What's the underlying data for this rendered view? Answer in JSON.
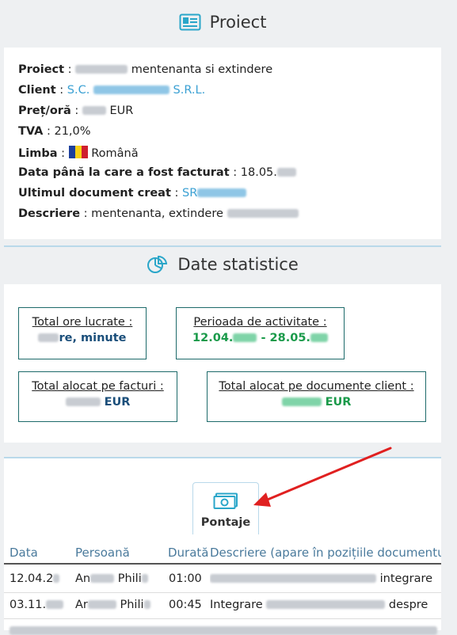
{
  "project_section": {
    "title": "Proiect",
    "fields": [
      {
        "label": "Proiect",
        "value": "mentenanta si extindere"
      },
      {
        "label": "Client",
        "value_pre": "S.C.",
        "value_post": "S.R.L."
      },
      {
        "label": "Preț/oră",
        "value": "EUR"
      },
      {
        "label": "TVA",
        "value": "21,0%"
      },
      {
        "label": "Limba",
        "value": "Română"
      },
      {
        "label": "Data până la care a fost facturat",
        "value": "18.05."
      },
      {
        "label": "Ultimul document creat",
        "value": "SR"
      },
      {
        "label": "Descriere",
        "value": "mentenanta, extindere"
      }
    ]
  },
  "stats_section": {
    "title": "Date statistice",
    "total_hours": {
      "label": "Total ore lucrate :",
      "value_post": "re, minute"
    },
    "activity_period": {
      "label": "Perioada de activitate :",
      "value_pre": "12.04.",
      "value_post": "- 28.05."
    },
    "total_invoices": {
      "label": "Total alocat pe facturi :",
      "value": "EUR"
    },
    "total_client_docs": {
      "label": "Total alocat pe documente client :",
      "value": "EUR"
    }
  },
  "timesheet": {
    "tab_label": "Pontaje",
    "headers": [
      "Data",
      "Persoană",
      "Durată",
      "Descriere (apare în pozițiile documentului)"
    ],
    "rows": [
      {
        "date": "12.04.2",
        "person_a": "An",
        "person_b": "Phili",
        "duration": "01:00",
        "desc_pre": "",
        "desc_post": "integrare"
      },
      {
        "date": "03.11.",
        "person_a": "Ar",
        "person_b": "Phili",
        "duration": "00:45",
        "desc_pre": "Integrare",
        "desc_post": "despre"
      }
    ]
  },
  "colors": {
    "accent": "#3aa0d3",
    "green": "#1a9a4a",
    "arrow": "#e02020"
  }
}
